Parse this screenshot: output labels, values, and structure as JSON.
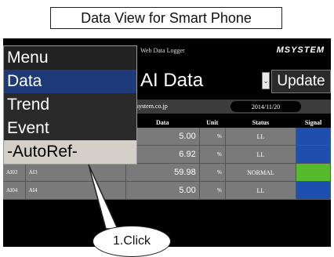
{
  "caption": "Data View for Smart Phone",
  "header": {
    "logger_label": "Web Data Logger",
    "brand": "MSYSTEM",
    "page_title": "AI Data",
    "dropdown_glyph": "⌄",
    "update_label": "Update"
  },
  "info": {
    "url": "www.m-system.co.jp",
    "date": "2014/11/20"
  },
  "table": {
    "columns": [
      "Data",
      "Unit",
      "Status",
      "Signal"
    ],
    "rows": [
      {
        "tag": "",
        "name": "",
        "data": "5.00",
        "unit": "%",
        "status": "LL",
        "signal_color": "#1e4fae"
      },
      {
        "tag": "",
        "name": "",
        "data": "6.92",
        "unit": "%",
        "status": "LL",
        "signal_color": "#1e4fae"
      },
      {
        "tag": "AI03",
        "name": "AI3",
        "data": "59.98",
        "unit": "%",
        "status": "NORMAL",
        "signal_color": "#55bb2c"
      },
      {
        "tag": "AI04",
        "name": "AI4",
        "data": "5.00",
        "unit": "%",
        "status": "LL",
        "signal_color": "#1e4fae"
      }
    ]
  },
  "menu": {
    "title": "Menu",
    "items": [
      {
        "label": "Data",
        "bg": "#1f3a78",
        "color": "#ffffff"
      },
      {
        "label": "Trend",
        "bg": "#2a2a2a",
        "color": "#ffffff"
      },
      {
        "label": "Event",
        "bg": "#2a2a2a",
        "color": "#ffffff"
      },
      {
        "label": "-AutoRef-",
        "bg": "#d4d0c8",
        "color": "#000000"
      }
    ]
  },
  "callout": "1.Click"
}
